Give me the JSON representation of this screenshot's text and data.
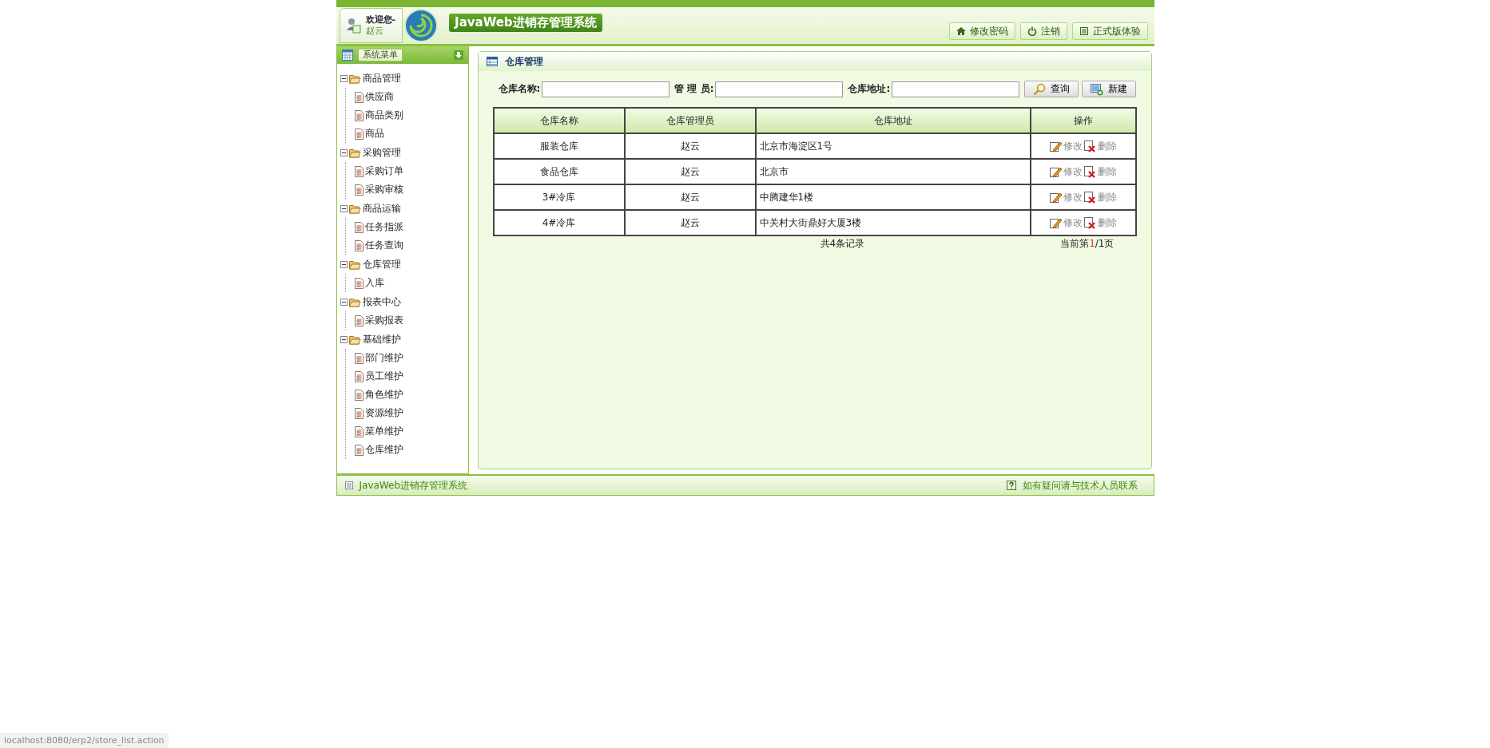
{
  "header": {
    "welcome": "欢迎您-",
    "user": "赵云",
    "title": "JavaWeb进销存管理系统",
    "buttons": [
      {
        "kind": "home",
        "label": "修改密码"
      },
      {
        "kind": "power",
        "label": "注销"
      },
      {
        "kind": "doc",
        "label": "正式版体验"
      }
    ]
  },
  "sidebar": {
    "title": "系统菜单",
    "items": [
      {
        "label": "商品管理",
        "expanded": true,
        "children": [
          {
            "label": "供应商"
          },
          {
            "label": "商品类别"
          },
          {
            "label": "商品"
          }
        ]
      },
      {
        "label": "采购管理",
        "expanded": true,
        "children": [
          {
            "label": "采购订单"
          },
          {
            "label": "采购审核"
          }
        ]
      },
      {
        "label": "商品运输",
        "expanded": true,
        "children": [
          {
            "label": "任务指派"
          },
          {
            "label": "任务查询"
          }
        ]
      },
      {
        "label": "仓库管理",
        "expanded": true,
        "children": [
          {
            "label": "入库"
          }
        ]
      },
      {
        "label": "报表中心",
        "expanded": true,
        "children": [
          {
            "label": "采购报表"
          }
        ]
      },
      {
        "label": "基础维护",
        "expanded": true,
        "children": [
          {
            "label": "部门维护"
          },
          {
            "label": "员工维护"
          },
          {
            "label": "角色维护"
          },
          {
            "label": "资源维护"
          },
          {
            "label": "菜单维护"
          },
          {
            "label": "仓库维护"
          }
        ]
      }
    ]
  },
  "panel": {
    "title": "仓库管理",
    "filters": [
      {
        "label": "仓库名称:"
      },
      {
        "label": "管 理 员:"
      },
      {
        "label": "仓库地址:"
      }
    ],
    "actions": [
      {
        "kind": "search",
        "label": "查询"
      },
      {
        "kind": "new",
        "label": "新建"
      }
    ],
    "table": {
      "columns": [
        "仓库名称",
        "仓库管理员",
        "仓库地址",
        "操作"
      ],
      "rows": [
        {
          "cells": [
            "服装仓库",
            "赵云",
            "北京市海淀区1号"
          ],
          "edit": "修改",
          "delete": "删除"
        },
        {
          "cells": [
            "食品仓库",
            "赵云",
            "北京市"
          ],
          "edit": "修改",
          "delete": "删除"
        },
        {
          "cells": [
            "3#冷库",
            "赵云",
            "中腾建华1楼"
          ],
          "edit": "修改",
          "delete": "删除"
        },
        {
          "cells": [
            "4#冷库",
            "赵云",
            "中关村大街鼎好大厦3楼"
          ],
          "edit": "修改",
          "delete": "删除"
        }
      ]
    },
    "total": "共4条记录",
    "pager": {
      "prefix": "当前第",
      "current": "1",
      "suffix": "/1页"
    }
  },
  "footer": {
    "left": "JavaWeb进销存管理系统",
    "right": "如有疑问请与技术人员联系"
  },
  "status_url": "localhost:8080/erp2/store_list.action"
}
